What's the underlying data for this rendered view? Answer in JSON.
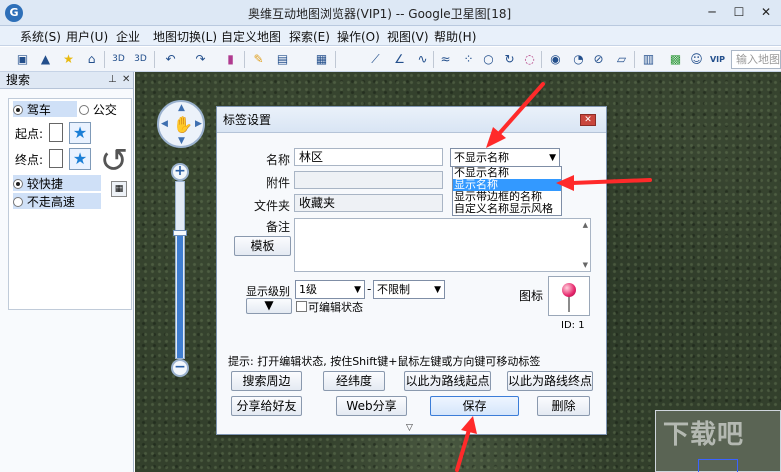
{
  "window": {
    "title": "奥维互动地图浏览器(VIP1) -- Google卫星图[18]",
    "logo": "globe-logo-icon"
  },
  "menu": [
    "系统(S)",
    "用户(U)",
    "企业",
    "地图切换(L)",
    "自定义地图",
    "探索(E)",
    "操作(O)",
    "视图(V)",
    "帮助(H)"
  ],
  "toolbar": {
    "icons": [
      "save-icon",
      "bookmark-icon",
      "star-icon",
      "network-icon",
      "3d-icon",
      "3d-2d-icon",
      "undo-icon",
      "redo-icon",
      "delete-icon",
      "pencil-icon",
      "card-icon",
      "map-doc-icon",
      "line-icon",
      "angle-icon",
      "curve-icon",
      "path-icon",
      "scatter-icon",
      "circle-icon",
      "rotate-icon",
      "gps-icon",
      "globe-icon",
      "clock-icon",
      "ruler-icon",
      "eraser-icon",
      "calculator-icon",
      "chat-icon",
      "person-icon",
      "vip-icon"
    ],
    "label_3d": "3D",
    "label_3d2d": "3D",
    "label_vip": "VIP",
    "search_placeholder": "输入地图"
  },
  "search_panel": {
    "title": "搜索",
    "modes": {
      "drive": "驾车",
      "transit": "公交"
    },
    "start_label": "起点:",
    "end_label": "终点:",
    "options": {
      "fast": "较快捷",
      "no_highway": "不走高速"
    }
  },
  "dialog": {
    "title": "标签设置",
    "name_label": "名称",
    "name_value": "林区",
    "attach_label": "附件",
    "attach_value": "",
    "folder_label": "文件夹",
    "folder_value": "收藏夹",
    "note_label": "备注",
    "template_button": "模板",
    "name_display_select": "不显示名称",
    "name_display_options": [
      "不显示名称",
      "显示名称",
      "显示带边框的名称",
      "自定义名称显示风格"
    ],
    "selected_option_index": 1,
    "level_label": "显示级别",
    "level_from": "1级",
    "level_separator": "-",
    "level_to": "不限制",
    "editable_label": "可编辑状态",
    "icon_label": "图标",
    "icon_id": "ID: 1",
    "hint": "提示: 打开编辑状态, 按住Shift键+鼠标左键或方向键可移动标签",
    "buttons": {
      "search_nearby": "搜索周边",
      "lat_lng": "经纬度",
      "route_start": "以此为路线起点",
      "route_end": "以此为路线终点",
      "share_friend": "分享给好友",
      "web_share": "Web分享",
      "save": "保存",
      "delete": "删除"
    }
  },
  "map": {
    "watermark": "下载吧",
    "annotation_color": "#ff2a2a"
  }
}
